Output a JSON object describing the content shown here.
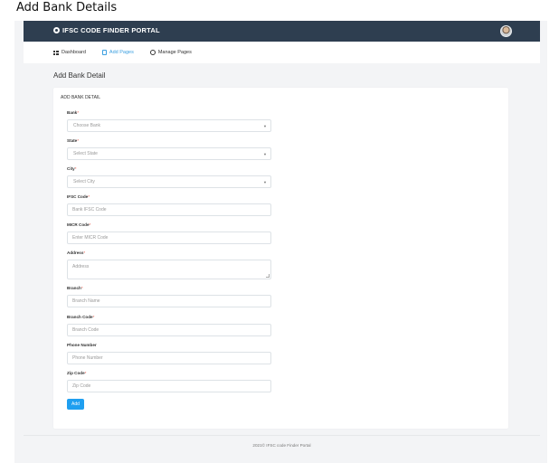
{
  "doc_heading": "Add Bank Details",
  "topbar": {
    "brand": "IFSC CODE FINDER PORTAL"
  },
  "nav": {
    "items": [
      {
        "label": "Dashboard"
      },
      {
        "label": "Add Pages"
      },
      {
        "label": "Manage Pages"
      }
    ]
  },
  "page_title": "Add Bank Detail",
  "card_title": "ADD BANK DETAIL",
  "form": {
    "bank": {
      "label": "Bank",
      "value": "Choose Bank"
    },
    "state": {
      "label": "State",
      "value": "Select State"
    },
    "city": {
      "label": "City",
      "value": "Select City"
    },
    "ifsc": {
      "label": "IFSC Code",
      "placeholder": "Bank IFSC Code"
    },
    "micr": {
      "label": "MICR Code",
      "placeholder": "Enter MICR Code"
    },
    "address": {
      "label": "Address",
      "placeholder": "Address"
    },
    "branch": {
      "label": "Branch",
      "placeholder": "Branch Name"
    },
    "branch_code": {
      "label": "Branch Code",
      "placeholder": "Branch Code"
    },
    "phone": {
      "label": "Phone Number",
      "placeholder": "Phone Number"
    },
    "zip": {
      "label": "Zip Code",
      "placeholder": "Zip Code"
    },
    "submit_label": "Add"
  },
  "footer": "2021© IFSC code Finder Portal",
  "colors": {
    "topbar": "#2e3e50",
    "accent": "#1f9ff0",
    "required": "#e74c3c"
  }
}
